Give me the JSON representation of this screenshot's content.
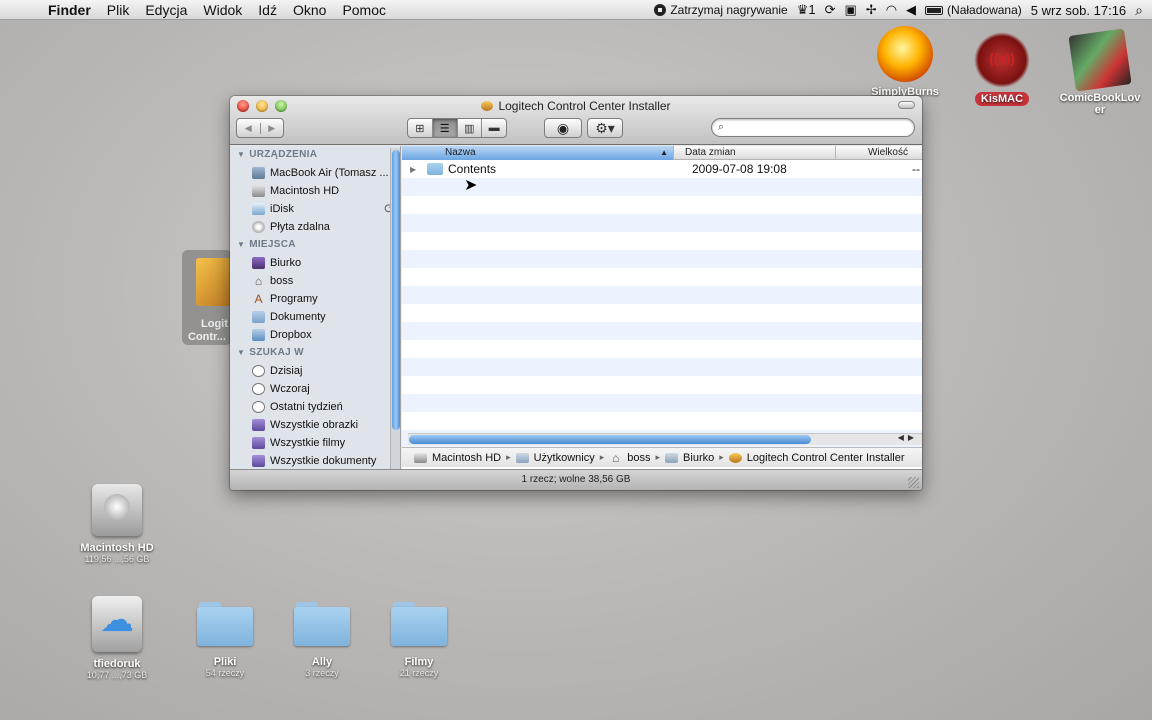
{
  "menubar": {
    "apple": "",
    "app": "Finder",
    "menus": [
      "Plik",
      "Edycja",
      "Widok",
      "Idź",
      "Okno",
      "Pomoc"
    ],
    "recording": "Zatrzymaj nagrywanie",
    "user_count": "1",
    "battery": "(Naładowana)",
    "clock": "5 wrz sob.  17:16"
  },
  "desktop": {
    "top_icons": [
      {
        "label": "SimplyBurns"
      },
      {
        "label": "KisMAC"
      },
      {
        "label": "ComicBookLover"
      }
    ],
    "installer_label": [
      "Logit",
      "Contr..."
    ],
    "macintosh_hd": {
      "label": "Macintosh HD",
      "sub": "119,56 ...,56 GB"
    },
    "tfiedoruk": {
      "label": "tfiedoruk",
      "sub": "10,77 ...,73 GB"
    },
    "folders": [
      {
        "label": "Pliki",
        "sub": "54 rzeczy"
      },
      {
        "label": "Ally",
        "sub": "3 rzeczy"
      },
      {
        "label": "Filmy",
        "sub": "21 rzeczy"
      }
    ]
  },
  "window": {
    "title": "Logitech Control Center Installer",
    "search_placeholder": "",
    "sidebar": {
      "devices_header": "URZĄDZENIA",
      "devices": [
        "MacBook Air (Tomasz ...",
        "Macintosh HD",
        "iDisk",
        "Płyta zdalna"
      ],
      "places_header": "MIEJSCA",
      "places": [
        "Biurko",
        "boss",
        "Programy",
        "Dokumenty",
        "Dropbox"
      ],
      "search_header": "SZUKAJ W",
      "searches": [
        "Dzisiaj",
        "Wczoraj",
        "Ostatni tydzień",
        "Wszystkie obrazki",
        "Wszystkie filmy",
        "Wszystkie dokumenty"
      ]
    },
    "columns": {
      "name": "Nazwa",
      "date": "Data zmian",
      "size": "Wielkość"
    },
    "rows": [
      {
        "name": "Contents",
        "date": "2009-07-08 19:08",
        "size": "--"
      }
    ],
    "path": [
      "Macintosh HD",
      "Użytkownicy",
      "boss",
      "Biurko",
      "Logitech Control Center Installer"
    ],
    "status": "1 rzecz; wolne 38,56 GB"
  },
  "colors": {
    "selection": "#6aa5e4",
    "sidebar_bg": "#dee4ea",
    "stripe": "#edf3fe"
  }
}
